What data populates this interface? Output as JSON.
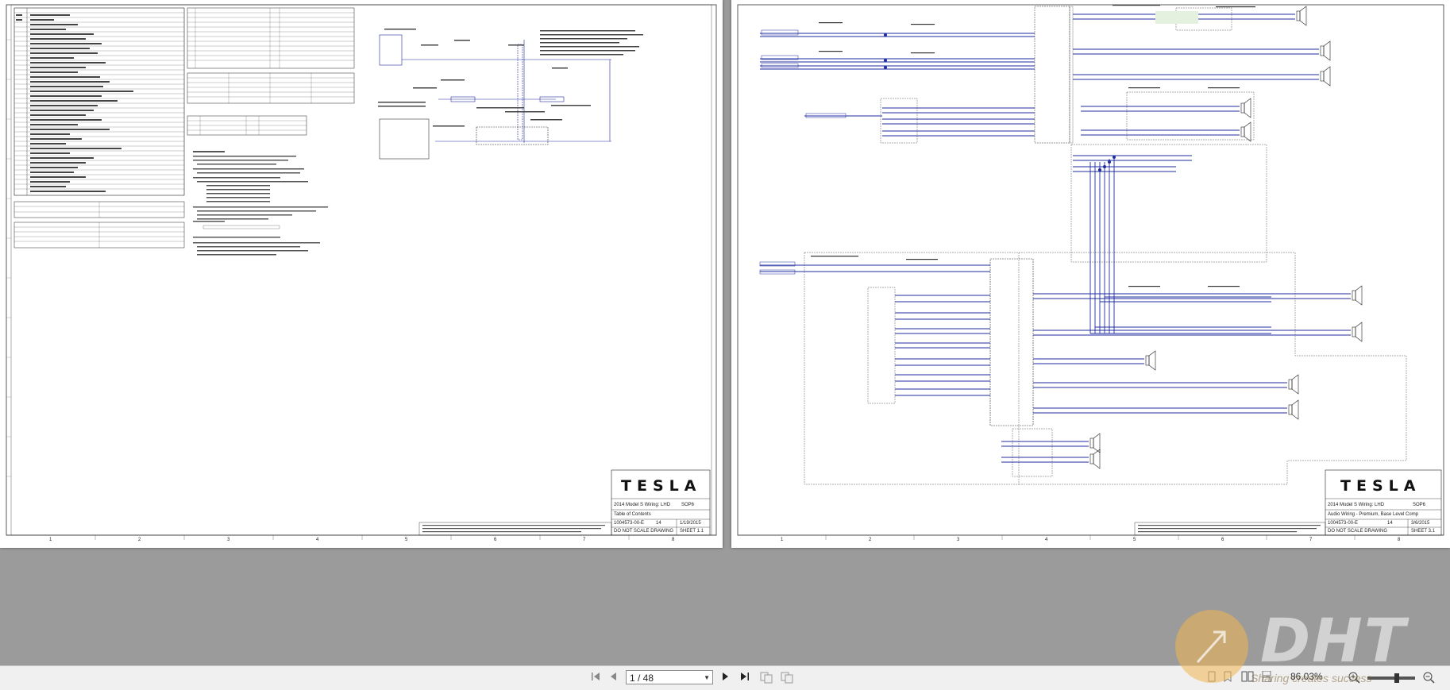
{
  "left_page": {
    "section_header": "Section",
    "description_header": "DESCRIPTION",
    "table_a_title": "Table A: Harness Designation",
    "table_b_title": "Table B: Wire Color Designation",
    "table_c_title": "Table C: Wire Type Designation",
    "note_text": "Striped wires are indicated by base-color code \"/\" then stripe color code. \"BK-BK\" indicates a brown wire with a black stripe.",
    "general_notes": "General Notes",
    "title_block": {
      "logo": "TESLA",
      "model": "2014 Model S Wiring: LHD",
      "sop": "SOP6",
      "title": "Table of Contents",
      "doc_number": "1004573-00-E",
      "rev": "14",
      "date": "1/19/2015",
      "scale_note": "DO NOT SCALE DRAWING",
      "sheet": "SHEET 1.1"
    }
  },
  "right_page": {
    "title_block": {
      "logo": "TESLA",
      "model": "2014 Model S Wiring: LHD",
      "sop": "SOP6",
      "title": "Audio Wiring - Premium, Base Level Comp",
      "doc_number": "1004573-00-E",
      "rev": "14",
      "date": "3/6/2015",
      "scale_note": "DO NOT SCALE DRAWING",
      "sheet": "SHEET 3.1"
    }
  },
  "toolbar": {
    "page_indicator": "1 / 48",
    "zoom": "86.03%",
    "icons": [
      "first-page-icon",
      "prev-page-icon",
      "next-page-icon",
      "last-page-icon",
      "fit-page-icon",
      "fit-width-icon",
      "zoom-out-icon",
      "zoom-in-icon"
    ]
  },
  "watermark": {
    "brand": "DHT",
    "tagline": "Sharing creates success"
  },
  "colors": {
    "wire_blue": "#1f2ba0",
    "viewer_bg": "#9b9b9b",
    "toolbar_bg": "#f0f0f0"
  }
}
